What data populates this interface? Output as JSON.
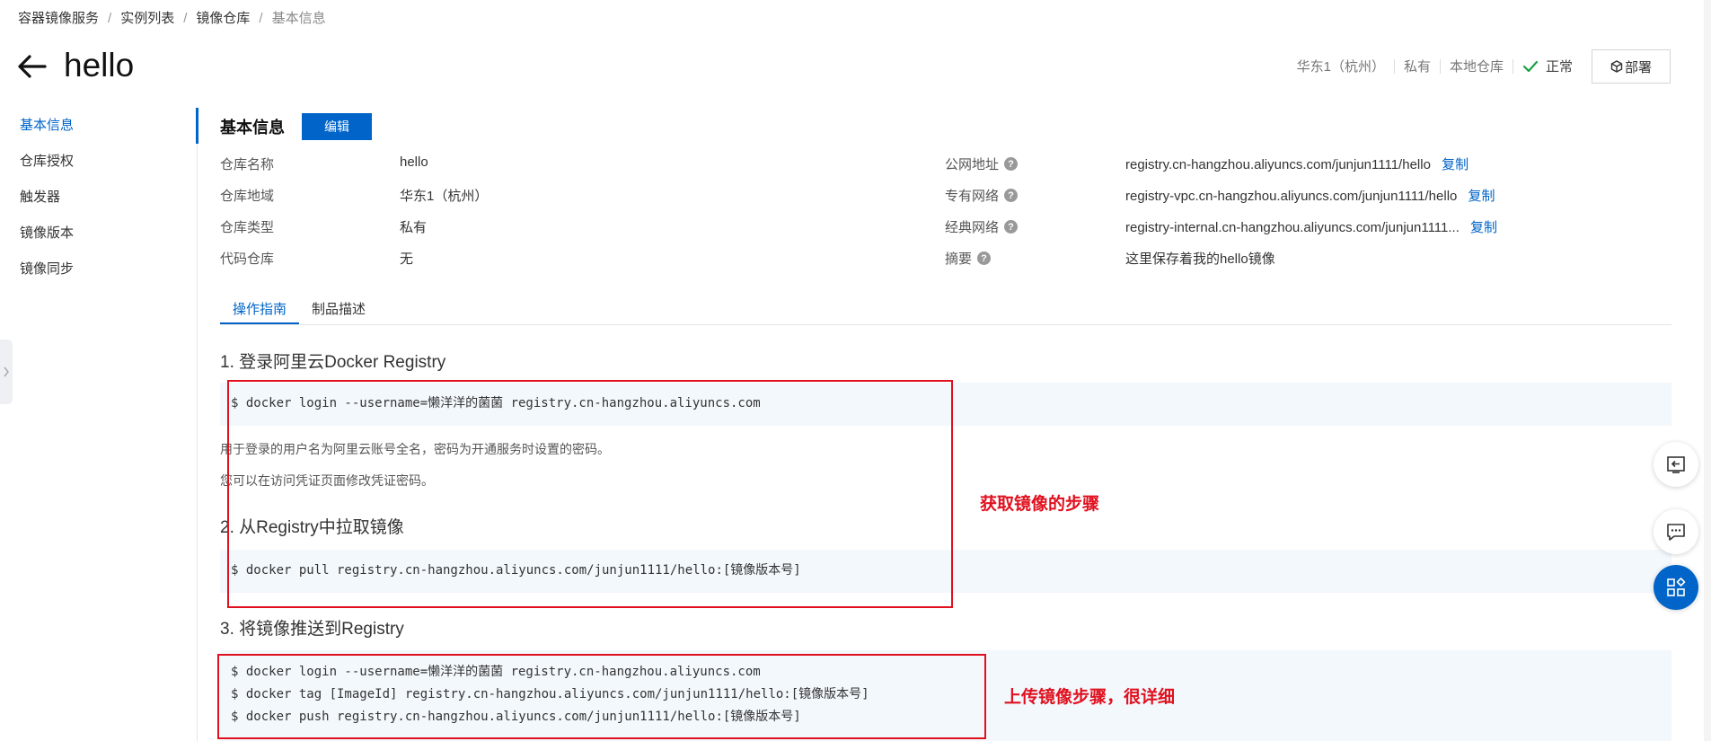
{
  "breadcrumb": [
    "容器镜像服务",
    "实例列表",
    "镜像仓库",
    "基本信息"
  ],
  "header": {
    "title": "hello",
    "region": "华东1（杭州）",
    "visibility": "私有",
    "repo_source": "本地仓库",
    "status": "正常",
    "deploy_label": "部署"
  },
  "sidenav": [
    "基本信息",
    "仓库授权",
    "触发器",
    "镜像版本",
    "镜像同步"
  ],
  "section": {
    "title": "基本信息",
    "edit_label": "编辑"
  },
  "info_left": [
    {
      "label": "仓库名称",
      "value": "hello"
    },
    {
      "label": "仓库地域",
      "value": "华东1（杭州）"
    },
    {
      "label": "仓库类型",
      "value": "私有"
    },
    {
      "label": "代码仓库",
      "value": "无"
    }
  ],
  "info_right": [
    {
      "label": "公网地址",
      "value": "registry.cn-hangzhou.aliyuncs.com/junjun1111/hello",
      "action": "复制"
    },
    {
      "label": "专有网络",
      "value": "registry-vpc.cn-hangzhou.aliyuncs.com/junjun1111/hello",
      "action": "复制"
    },
    {
      "label": "经典网络",
      "value": "registry-internal.cn-hangzhou.aliyuncs.com/junjun1111...",
      "action": "复制"
    },
    {
      "label": "摘要",
      "value": "这里保存着我的hello镜像"
    }
  ],
  "help_glyph": "?",
  "tabs": [
    "操作指南",
    "制品描述"
  ],
  "guide": {
    "step1": {
      "title": "1. 登录阿里云Docker Registry",
      "code": "$ docker login --username=懒洋洋的菌菌 registry.cn-hangzhou.aliyuncs.com",
      "desc1": "用于登录的用户名为阿里云账号全名，密码为开通服务时设置的密码。",
      "desc2": "您可以在访问凭证页面修改凭证密码。"
    },
    "step2": {
      "title": "2. 从Registry中拉取镜像",
      "code": "$ docker pull registry.cn-hangzhou.aliyuncs.com/junjun1111/hello:[镜像版本号]"
    },
    "step3": {
      "title": "3. 将镜像推送到Registry",
      "code": [
        "$ docker login --username=懒洋洋的菌菌 registry.cn-hangzhou.aliyuncs.com",
        "$ docker tag [ImageId] registry.cn-hangzhou.aliyuncs.com/junjun1111/hello:[镜像版本号]",
        "$ docker push registry.cn-hangzhou.aliyuncs.com/junjun1111/hello:[镜像版本号]"
      ]
    }
  },
  "annotations": {
    "pull_note": "获取镜像的步骤",
    "push_note": "上传镜像步骤，很详细",
    "color": "#e0101e"
  },
  "colors": {
    "accent": "#0064c8",
    "code_bg": "#f3f8fd",
    "ok_green": "#1aa146"
  }
}
